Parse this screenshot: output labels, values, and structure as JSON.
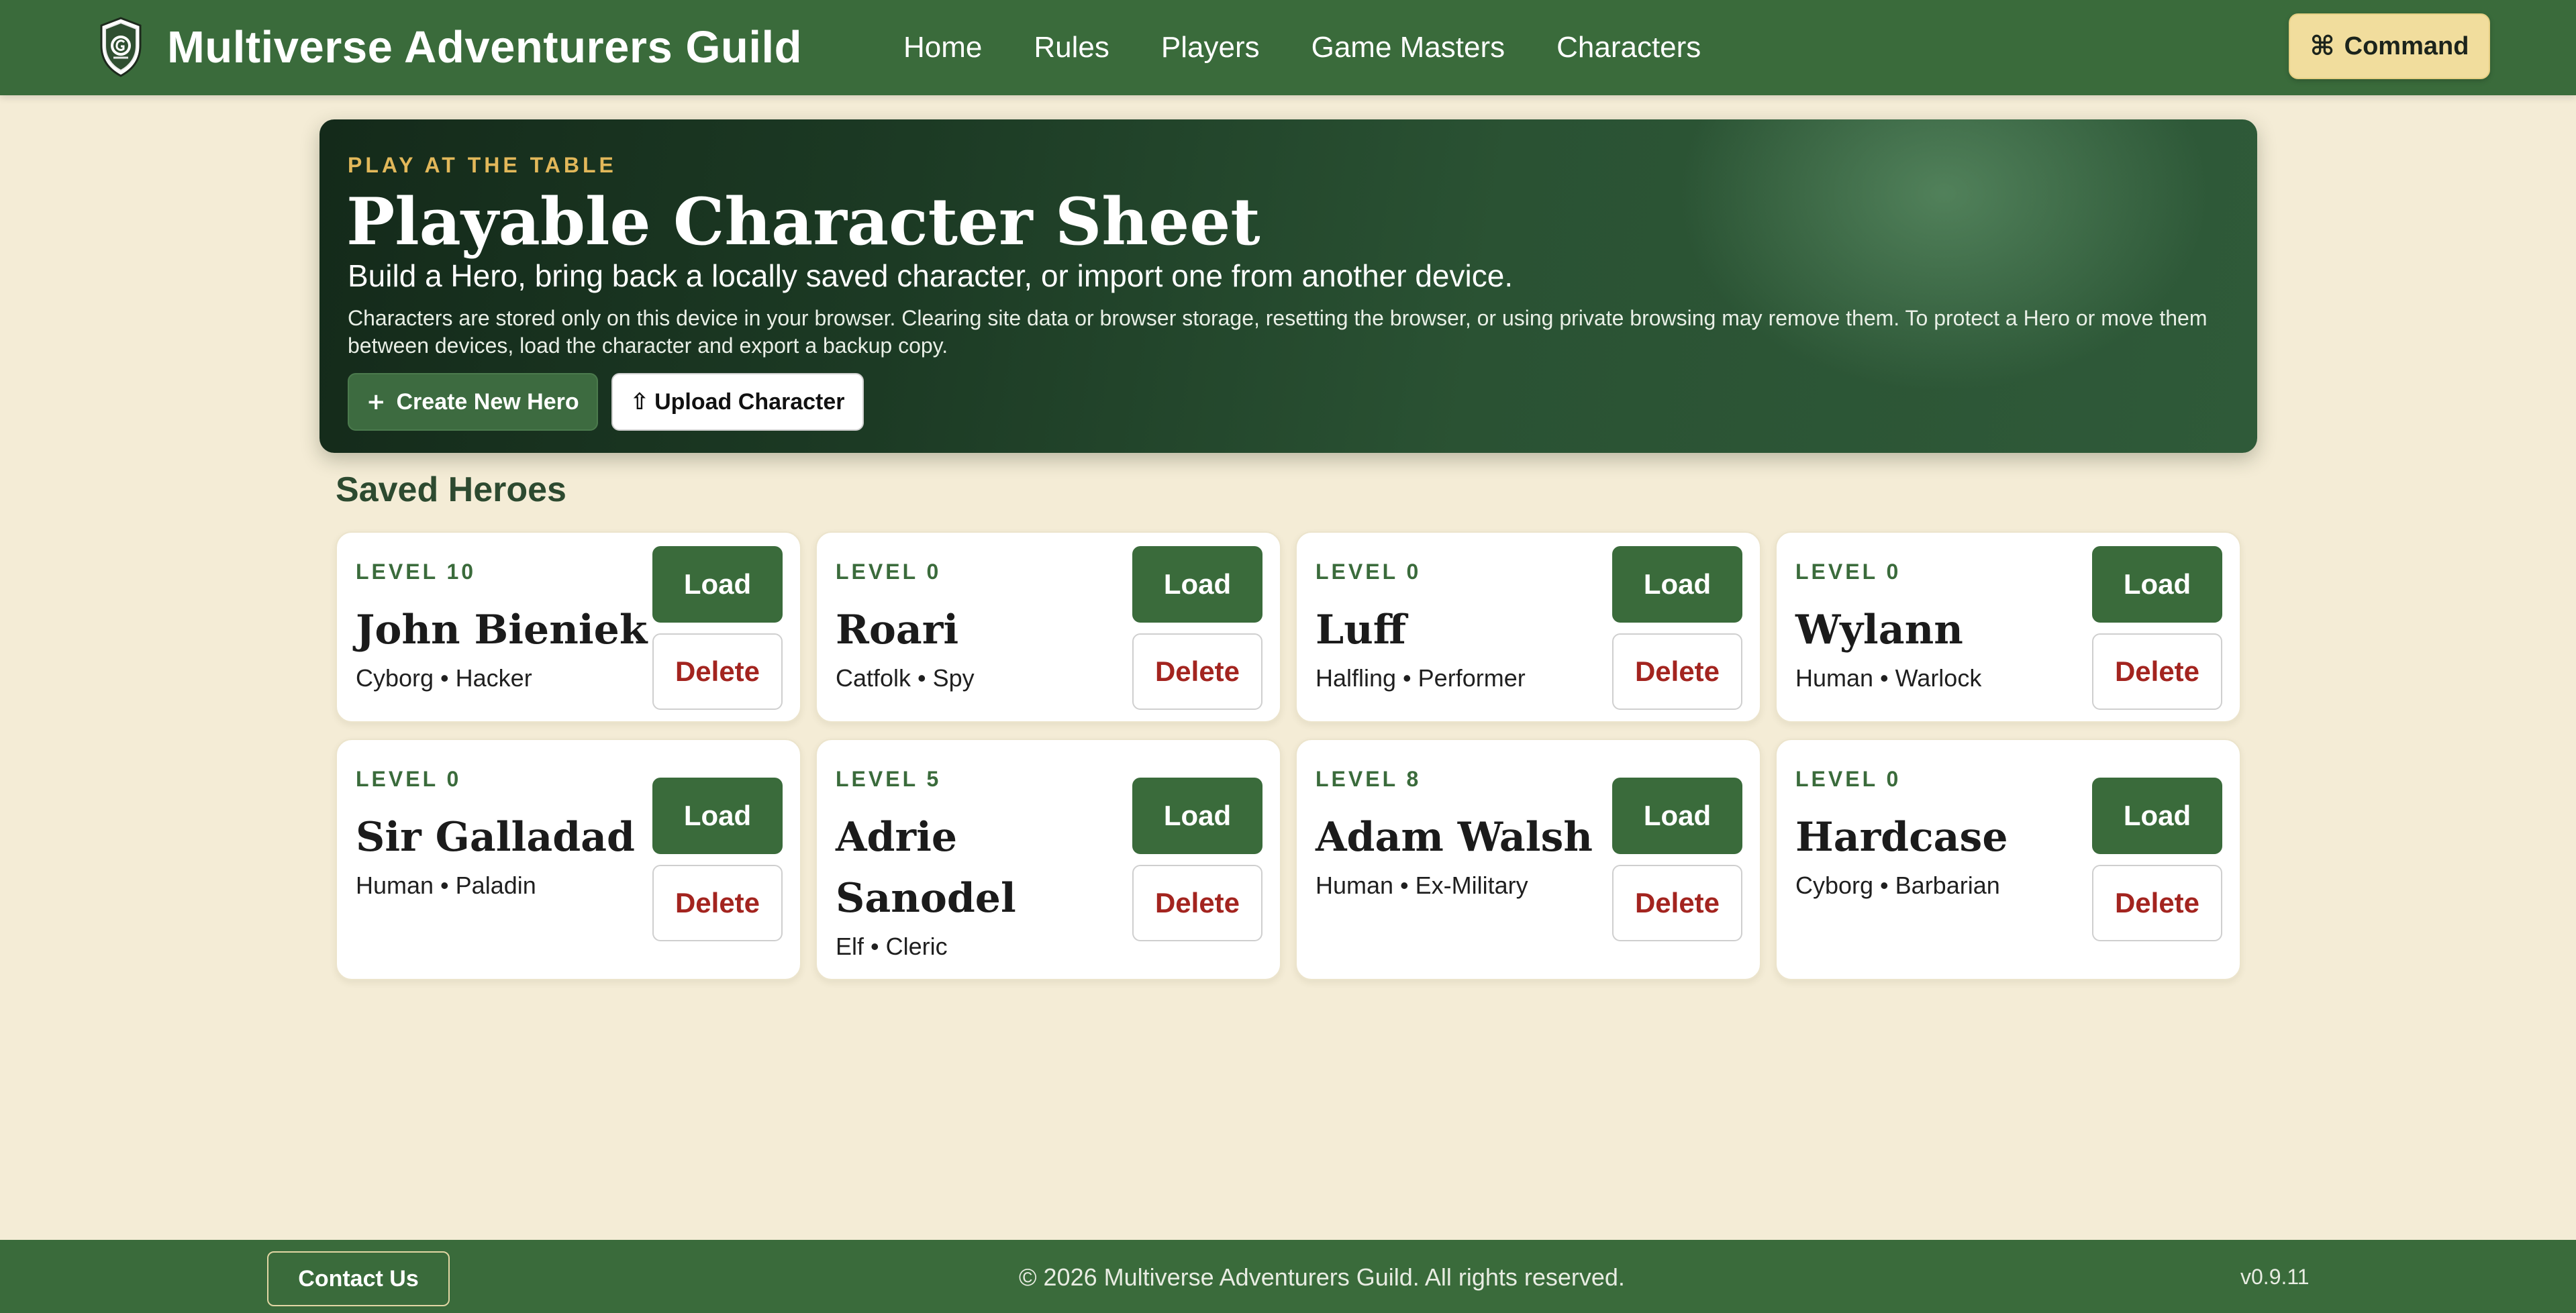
{
  "header": {
    "brand_title": "Multiverse Adventurers Guild",
    "nav": [
      "Home",
      "Rules",
      "Players",
      "Game Masters",
      "Characters"
    ],
    "command_label": "Command",
    "command_icon": "command-key-icon"
  },
  "hero": {
    "eyebrow": "PLAY AT THE TABLE",
    "title": "Playable Character Sheet",
    "subtitle": "Build a Hero, bring back a locally saved character, or import one from another device.",
    "note": "Characters are stored only on this device in your browser. Clearing site data or browser storage, resetting the browser, or using private browsing may remove them. To protect a Hero or move them between devices, load the character and export a backup copy.",
    "create_label": "Create New Hero",
    "create_icon": "plus-icon",
    "upload_label": "Upload Character",
    "upload_icon": "upload-arrow-icon"
  },
  "saved": {
    "title": "Saved Heroes",
    "load_label": "Load",
    "delete_label": "Delete",
    "heroes": [
      {
        "level": "LEVEL 10",
        "name": "John Bieniek",
        "meta": "Cyborg • Hacker"
      },
      {
        "level": "LEVEL 0",
        "name": "Roari",
        "meta": "Catfolk • Spy"
      },
      {
        "level": "LEVEL 0",
        "name": "Luff",
        "meta": "Halfling • Performer"
      },
      {
        "level": "LEVEL 0",
        "name": "Wylann",
        "meta": "Human • Warlock"
      },
      {
        "level": "LEVEL 0",
        "name": "Sir Galladad",
        "meta": "Human • Paladin"
      },
      {
        "level": "LEVEL 5",
        "name": "Adrie Sanodel",
        "meta": "Elf • Cleric"
      },
      {
        "level": "LEVEL 8",
        "name": "Adam Walsh",
        "meta": "Human • Ex-Military"
      },
      {
        "level": "LEVEL 0",
        "name": "Hardcase",
        "meta": "Cyborg • Barbarian"
      }
    ]
  },
  "footer": {
    "contact_label": "Contact Us",
    "copyright": "© 2026 Multiverse Adventurers Guild. All rights reserved.",
    "version": "v0.9.11"
  },
  "colors": {
    "header_green": "#3a6b3b",
    "page_bg": "#f4ecd6",
    "accent_gold": "#e2b85a",
    "command_bg": "#f1dd9d",
    "delete_red": "#a3241f"
  }
}
